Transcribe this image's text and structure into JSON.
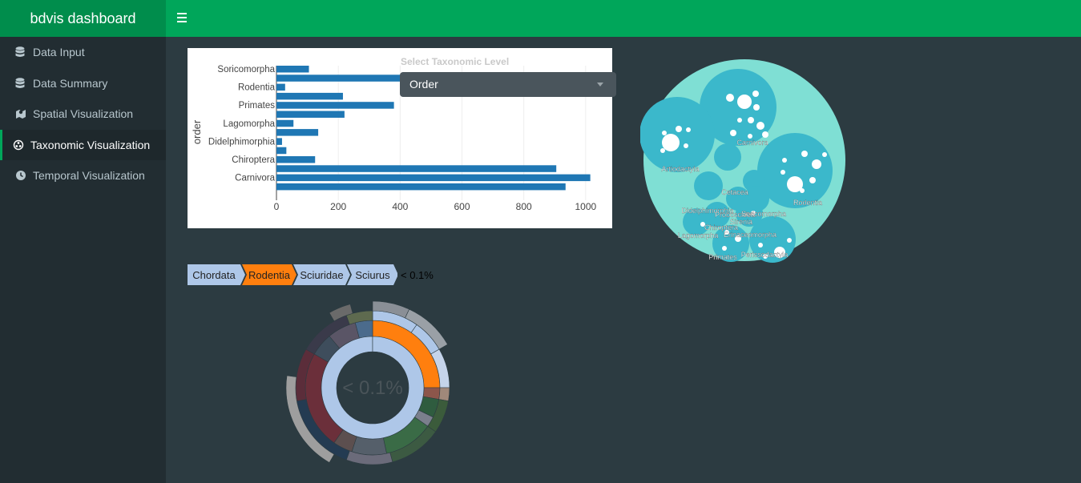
{
  "app": {
    "title": "bdvis dashboard"
  },
  "sidebar": {
    "items": [
      {
        "label": "Data Input",
        "icon": "database-icon"
      },
      {
        "label": "Data Summary",
        "icon": "database-icon"
      },
      {
        "label": "Spatial Visualization",
        "icon": "map-icon"
      },
      {
        "label": "Taxonomic Visualization",
        "icon": "tree-icon",
        "active": true
      },
      {
        "label": "Temporal Visualization",
        "icon": "clock-icon"
      }
    ]
  },
  "colors": {
    "header": "#00a65a",
    "logo_bg": "#008d4c",
    "sidebar": "#222d32",
    "content": "#2c3b41",
    "bar": "#1f77b4",
    "pack_outer": "#7fdfd4",
    "pack_inner": "#3bb8cb",
    "orange": "#ff7f0e",
    "crumb": "#aec7e8"
  },
  "filters": {
    "label": "Select Taxonomic Level",
    "selected": "Order"
  },
  "chart_data": {
    "type": "bar",
    "orientation": "horizontal",
    "ylabel": "order",
    "categories": [
      "Soricomorpha",
      "",
      "Rodentia",
      "",
      "Primates",
      "",
      "Lagomorpha",
      "",
      "Didelphimorphia",
      "",
      "Chiroptera",
      "",
      "Carnivora",
      "",
      ""
    ],
    "values": [
      105,
      495,
      28,
      215,
      380,
      220,
      55,
      135,
      18,
      32,
      125,
      905,
      1015,
      935
    ],
    "xticks": [
      0,
      200,
      400,
      600,
      800,
      1000
    ],
    "xlim": [
      0,
      1060
    ],
    "grid": true
  },
  "bar_categories": [
    "Soricomorpha",
    "Rodentia",
    "Primates",
    "Lagomorpha",
    "Didelphimorphia",
    "Chiroptera",
    "Carnivora"
  ],
  "packing": {
    "labels": [
      "Carnivora",
      "Artiodactyla",
      "Cetacea",
      "Didelphimorphia",
      "Proboscidea",
      "Soricomorpha",
      "Sirenia",
      "Chiroptera",
      "Erinaceomorpha",
      "Lagomorpha",
      "Primates",
      "Perissodactyla",
      "Rodentia"
    ]
  },
  "breadcrumb": {
    "items": [
      "Chordata",
      "Rodentia",
      "Sciuridae",
      "Sciurus"
    ],
    "percentage": "< 0.1%"
  },
  "sunburst": {
    "center_label": "< 0.1%"
  }
}
